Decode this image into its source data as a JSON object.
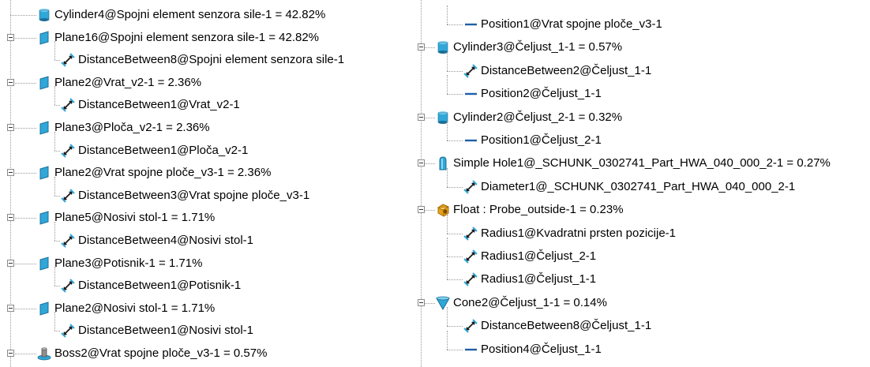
{
  "tree": {
    "left": [
      {
        "label": "Cylinder4@Spojni element senzora sile-1 = 42.82%",
        "icon": "cylinder-icon",
        "level": 0,
        "expander": false
      },
      {
        "label": "Plane16@Spojni element senzora sile-1 = 42.82%",
        "icon": "plane-icon",
        "level": 0,
        "expander": true
      },
      {
        "label": "DistanceBetween8@Spojni element senzora sile-1",
        "icon": "dimension-icon",
        "level": 1
      },
      {
        "label": "Plane2@Vrat_v2-1 = 2.36%",
        "icon": "plane-icon",
        "level": 0,
        "expander": true
      },
      {
        "label": "DistanceBetween1@Vrat_v2-1",
        "icon": "dimension-icon",
        "level": 1
      },
      {
        "label": "Plane3@Ploča_v2-1 = 2.36%",
        "icon": "plane-icon",
        "level": 0,
        "expander": true
      },
      {
        "label": "DistanceBetween1@Ploča_v2-1",
        "icon": "dimension-icon",
        "level": 1
      },
      {
        "label": "Plane2@Vrat spojne ploče_v3-1 = 2.36%",
        "icon": "plane-icon",
        "level": 0,
        "expander": true
      },
      {
        "label": "DistanceBetween3@Vrat spojne ploče_v3-1",
        "icon": "dimension-icon",
        "level": 1
      },
      {
        "label": "Plane5@Nosivi stol-1 = 1.71%",
        "icon": "plane-icon",
        "level": 0,
        "expander": true
      },
      {
        "label": "DistanceBetween4@Nosivi stol-1",
        "icon": "dimension-icon",
        "level": 1
      },
      {
        "label": "Plane3@Potisnik-1 = 1.71%",
        "icon": "plane-icon",
        "level": 0,
        "expander": true
      },
      {
        "label": "DistanceBetween1@Potisnik-1",
        "icon": "dimension-icon",
        "level": 1
      },
      {
        "label": "Plane2@Nosivi stol-1 = 1.71%",
        "icon": "plane-icon",
        "level": 0,
        "expander": true
      },
      {
        "label": "DistanceBetween1@Nosivi stol-1",
        "icon": "dimension-icon",
        "level": 1
      },
      {
        "label": "Boss2@Vrat spojne ploče_v3-1 = 0.57%",
        "icon": "boss-icon",
        "level": 0,
        "expander": true
      }
    ],
    "right": [
      {
        "label": "Position1@Vrat spojne ploče_v3-1",
        "icon": "position-icon",
        "level": 1
      },
      {
        "label": "Cylinder3@Čeljust_1-1 = 0.57%",
        "icon": "cylinder-icon",
        "level": 0,
        "expander": true
      },
      {
        "label": "DistanceBetween2@Čeljust_1-1",
        "icon": "dimension-icon",
        "level": 1
      },
      {
        "label": "Position2@Čeljust_1-1",
        "icon": "position-icon",
        "level": 1
      },
      {
        "label": "Cylinder2@Čeljust_2-1 = 0.32%",
        "icon": "cylinder-icon",
        "level": 0,
        "expander": true
      },
      {
        "label": "Position1@Čeljust_2-1",
        "icon": "position-icon",
        "level": 1
      },
      {
        "label": "Simple Hole1@_SCHUNK_0302741_Part_HWA_040_000_2-1 = 0.27%",
        "icon": "hole-icon",
        "level": 0,
        "expander": true
      },
      {
        "label": "Diameter1@_SCHUNK_0302741_Part_HWA_040_000_2-1",
        "icon": "dimension-icon",
        "level": 1
      },
      {
        "label": "Float : Probe_outside-1 = 0.23%",
        "icon": "float-icon",
        "level": 0,
        "expander": true
      },
      {
        "label": "Radius1@Kvadratni prsten pozicije-1",
        "icon": "dimension-icon",
        "level": 1
      },
      {
        "label": "Radius1@Čeljust_2-1",
        "icon": "dimension-icon",
        "level": 1
      },
      {
        "label": "Radius1@Čeljust_1-1",
        "icon": "dimension-icon",
        "level": 1
      },
      {
        "label": "Cone2@Čeljust_1-1 = 0.14%",
        "icon": "cone-icon",
        "level": 0,
        "expander": true
      },
      {
        "label": "DistanceBetween8@Čeljust_1-1",
        "icon": "dimension-icon",
        "level": 1
      },
      {
        "label": "Position4@Čeljust_1-1",
        "icon": "position-icon",
        "level": 1
      }
    ]
  },
  "colors": {
    "cyan": "#2fa7d8",
    "cyan_dark": "#1c6f96",
    "blue_line": "#1f5fa8",
    "gold": "#e5a21a",
    "gold_dark": "#a86c00"
  }
}
